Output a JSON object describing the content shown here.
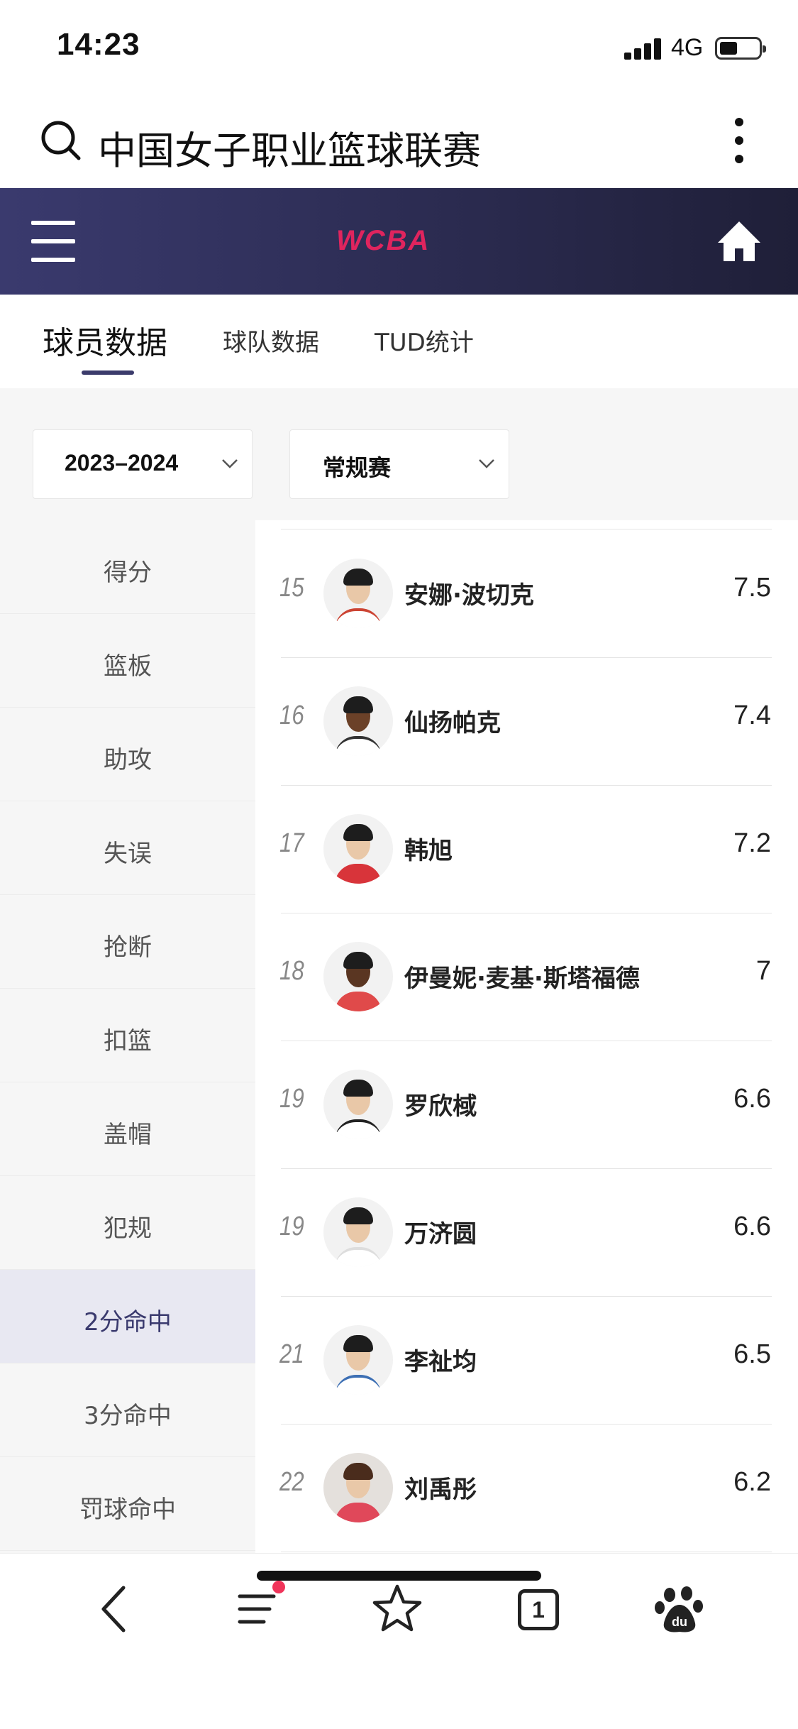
{
  "status_bar": {
    "time": "14:23",
    "network": "4G"
  },
  "search": {
    "query": "中国女子职业篮球联赛"
  },
  "header": {
    "logo_text": "WCBA",
    "accent_color": "#e0245e",
    "background_color": "#2a2a4e"
  },
  "tabs": [
    {
      "label": "球员数据",
      "active": true
    },
    {
      "label": "球队数据",
      "active": false
    },
    {
      "label": "TUD统计",
      "active": false
    }
  ],
  "filters": {
    "season": "2023–2024",
    "phase": "常规赛"
  },
  "categories": [
    {
      "label": "得分",
      "active": false
    },
    {
      "label": "篮板",
      "active": false
    },
    {
      "label": "助攻",
      "active": false
    },
    {
      "label": "失误",
      "active": false
    },
    {
      "label": "抢断",
      "active": false
    },
    {
      "label": "扣篮",
      "active": false
    },
    {
      "label": "盖帽",
      "active": false
    },
    {
      "label": "犯规",
      "active": false
    },
    {
      "label": "2分命中",
      "active": true
    },
    {
      "label": "3分命中",
      "active": false
    },
    {
      "label": "罚球命中",
      "active": false
    }
  ],
  "players": [
    {
      "rank": "15",
      "name": "安娜·波切克",
      "value": "7.5"
    },
    {
      "rank": "16",
      "name": "仙扬帕克",
      "value": "7.4"
    },
    {
      "rank": "17",
      "name": "韩旭",
      "value": "7.2"
    },
    {
      "rank": "18",
      "name": "伊曼妮·麦基·斯塔福德",
      "value": "7"
    },
    {
      "rank": "19",
      "name": "罗欣棫",
      "value": "6.6"
    },
    {
      "rank": "19",
      "name": "万济圆",
      "value": "6.6"
    },
    {
      "rank": "21",
      "name": "李祉均",
      "value": "6.5"
    },
    {
      "rank": "22",
      "name": "刘禹彤",
      "value": "6.2"
    }
  ],
  "bottom_nav": {
    "tab_count": "1",
    "items": [
      "back-icon",
      "menu-icon",
      "star-icon",
      "tabs-icon",
      "baidu-paw-icon"
    ]
  }
}
